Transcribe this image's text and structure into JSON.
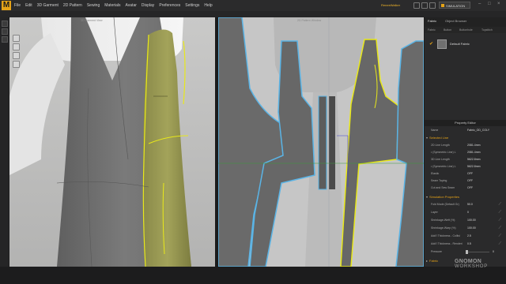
{
  "app": {
    "logo_letter": "M",
    "user_label": "ReneeWalker"
  },
  "menu": [
    "File",
    "Edit",
    "3D Garment",
    "2D Pattern",
    "Sewing",
    "Materials",
    "Avatar",
    "Display",
    "Preferences",
    "Settings",
    "Help"
  ],
  "toolbar": {
    "simulation_label": "SIMULATION"
  },
  "viewports": {
    "left_title": "3D Garment View",
    "right_title": "2D Pattern Window"
  },
  "right_panel": {
    "tabs": [
      "Fabric",
      "Object Browser"
    ],
    "subtabs": [
      "Fabric",
      "Button",
      "Buttonhole",
      "Topstitch"
    ],
    "fabric_item": {
      "label": "Default Fabric",
      "checked": true
    }
  },
  "property_editor": {
    "title": "Property Editor",
    "name_row": {
      "label": "Name",
      "value": "Fabric_OD_COLY"
    },
    "sections": [
      {
        "title": "Selected Line",
        "rows": [
          {
            "label": "2D Line Length",
            "value": "2081.4mm"
          },
          {
            "label": "• (Symmetric Line) L",
            "value": "2081.4mm"
          },
          {
            "label": "3D Line Length",
            "value": "5622.8mm"
          },
          {
            "label": "• (Symmetric Line) L",
            "value": "5622.8mm"
          },
          {
            "label": "Elastic",
            "value": "OFF"
          },
          {
            "label": "Seam Taping",
            "value": "OFF"
          },
          {
            "label": "Cut and Sew Seam",
            "value": "OFF"
          }
        ]
      },
      {
        "title": "Simulation Properties",
        "rows": [
          {
            "label": "Fold Mode (Default Gr)",
            "value": "50.0"
          },
          {
            "label": "Layer",
            "value": "0"
          },
          {
            "label": "Shrinkage-Weft (%)",
            "value": "100.00"
          },
          {
            "label": "Shrinkage-Warp (%)",
            "value": "100.00"
          },
          {
            "label": "Add'l Thickness - Collisi",
            "value": "2.5"
          },
          {
            "label": "Add'l Thickness - Renderi",
            "value": "0.5"
          },
          {
            "label": "Pressure",
            "value": "0"
          }
        ]
      },
      {
        "title": "Fabric",
        "rows": []
      }
    ]
  },
  "watermark": {
    "line1": "GNOMON",
    "line2": "WORKSHOP"
  },
  "colors": {
    "accent": "#e6a317",
    "pattern_line": "#5ab4e6",
    "selected_line": "#e8e81a"
  }
}
